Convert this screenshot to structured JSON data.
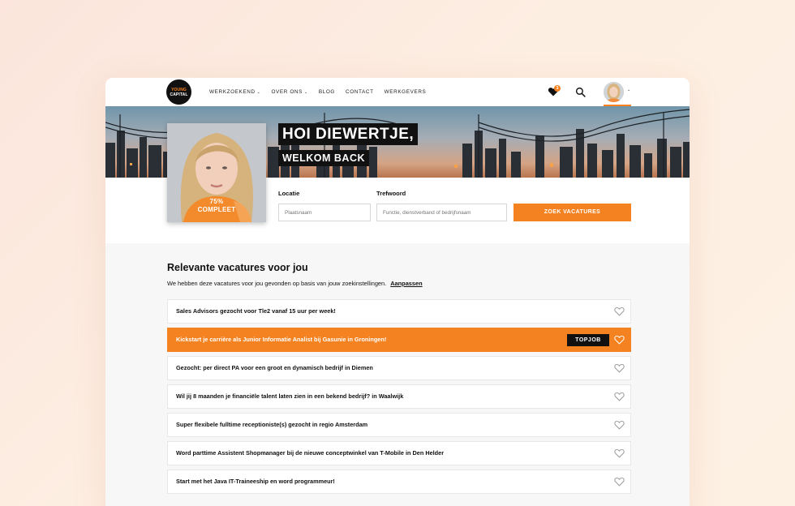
{
  "nav": {
    "logo_line1": "YOUNG",
    "logo_line2": "CAPITAL",
    "menu": [
      {
        "label": "WERKZOEKEND",
        "has_dropdown": true
      },
      {
        "label": "OVER ONS",
        "has_dropdown": true
      },
      {
        "label": "BLOG",
        "has_dropdown": false
      },
      {
        "label": "CONTACT",
        "has_dropdown": false
      },
      {
        "label": "WERKGEVERS",
        "has_dropdown": false
      }
    ],
    "favorites_count": "3",
    "icons": [
      "heart-icon",
      "search-icon",
      "chevron-down-icon"
    ]
  },
  "hero": {
    "greeting": "HOI DIEWERTJE,",
    "subtitle": "WELKOM BACK",
    "profile_progress": "75%",
    "profile_status": "COMPLEET"
  },
  "search": {
    "location_label": "Locatie",
    "location_placeholder": "Plaatsnaam",
    "keyword_label": "Trefwoord",
    "keyword_placeholder": "Functie, dienstverband of bedrijfsnaam",
    "button": "ZOEK VACATURES"
  },
  "vacancies": {
    "title": "Relevante vacatures voor jou",
    "subtitle": "We hebben deze vacatures voor jou gevonden op basis van jouw zoekinstellingen.",
    "adjust_link": "Aanpassen",
    "topjob_label": "TOPJOB",
    "items": [
      {
        "title": "Sales Advisors gezocht voor Tle2 vanaf 15 uur per week!",
        "topjob": false
      },
      {
        "title": "Kickstart je carrière als Junior Informatie Analist bij Gasunie in Groningen!",
        "topjob": true
      },
      {
        "title": "Gezocht: per direct PA voor een groot en dynamisch bedrijf in Diemen",
        "topjob": false
      },
      {
        "title": "Wil jij 8 maanden je financiële talent laten zien in een bekend bedrijf? in Waalwijk",
        "topjob": false
      },
      {
        "title": "Super flexibele fulltime receptioniste(s) gezocht in regio Amsterdam",
        "topjob": false
      },
      {
        "title": "Word parttime Assistent Shopmanager bij de nieuwe conceptwinkel van T-Mobile in Den Helder",
        "topjob": false
      },
      {
        "title": "Start met het Java IT-Traineeship en word programmeur!",
        "topjob": false
      }
    ]
  },
  "colors": {
    "accent": "#f58220",
    "dark": "#111111",
    "page_background": "#f7f7f7"
  }
}
